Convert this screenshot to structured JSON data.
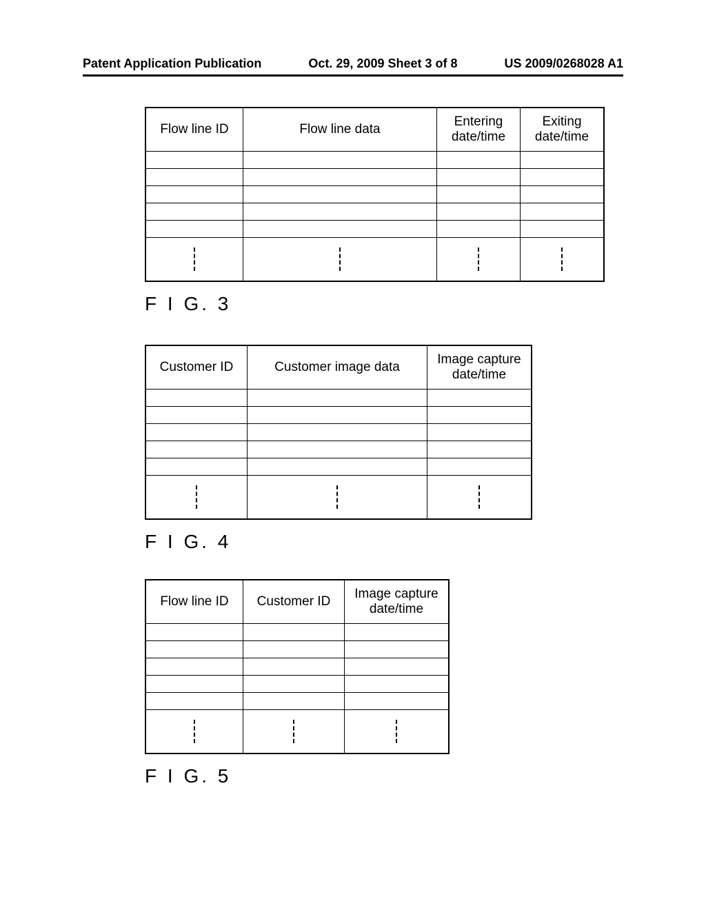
{
  "header": {
    "left": "Patent Application Publication",
    "center": "Oct. 29, 2009  Sheet 3 of 8",
    "right": "US 2009/0268028 A1"
  },
  "fig3": {
    "label": "F I G. 3",
    "columns": [
      "Flow line ID",
      "Flow line data",
      "Entering date/time",
      "Exiting date/time"
    ]
  },
  "fig4": {
    "label": "F I G. 4",
    "columns": [
      "Customer ID",
      "Customer image data",
      "Image capture date/time"
    ]
  },
  "fig5": {
    "label": "F I G. 5",
    "columns": [
      "Flow line ID",
      "Customer ID",
      "Image capture date/time"
    ]
  }
}
